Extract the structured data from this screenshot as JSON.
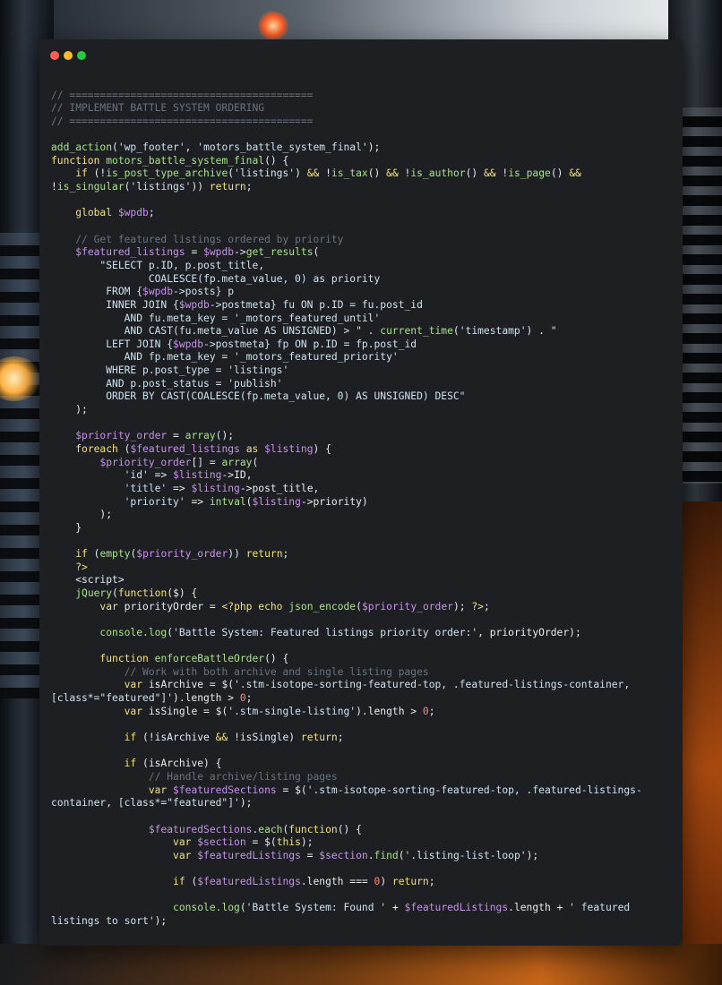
{
  "window": {
    "controls": {
      "close": "#ff5f57",
      "minimize": "#febc2e",
      "maximize": "#28c840"
    }
  },
  "theme": {
    "background": "#1d1f23",
    "colors": {
      "t": "#e6edf3",
      "c": "#6b737c",
      "k": "#f2e27a",
      "f": "#a8e28a",
      "v": "#c792ea",
      "s": "#cfe3ee",
      "h": "#ff7a7a",
      "n": "#ff8a7a"
    }
  },
  "code_lines": [
    [],
    [
      [
        "c",
        "// ========================================"
      ]
    ],
    [
      [
        "c",
        "// IMPLEMENT BATTLE SYSTEM ORDERING"
      ]
    ],
    [
      [
        "c",
        "// ========================================"
      ]
    ],
    [],
    [
      [
        "f",
        "add_action"
      ],
      [
        "t",
        "("
      ],
      [
        "s",
        "'wp_footer'"
      ],
      [
        "t",
        ", "
      ],
      [
        "s",
        "'motors_battle_system_final'"
      ],
      [
        "t",
        ");"
      ]
    ],
    [
      [
        "k",
        "function "
      ],
      [
        "f",
        "motors_battle_system_final"
      ],
      [
        "t",
        "() {"
      ]
    ],
    [
      [
        "t",
        "    "
      ],
      [
        "k",
        "if "
      ],
      [
        "t",
        "(!"
      ],
      [
        "f",
        "is_post_type_archive"
      ],
      [
        "t",
        "("
      ],
      [
        "s",
        "'listings'"
      ],
      [
        "t",
        ") "
      ],
      [
        "k",
        "&&"
      ],
      [
        "t",
        " !"
      ],
      [
        "f",
        "is_tax"
      ],
      [
        "t",
        "() "
      ],
      [
        "k",
        "&&"
      ],
      [
        "t",
        " !"
      ],
      [
        "f",
        "is_author"
      ],
      [
        "t",
        "() "
      ],
      [
        "k",
        "&&"
      ],
      [
        "t",
        " !"
      ],
      [
        "f",
        "is_page"
      ],
      [
        "t",
        "() "
      ],
      [
        "k",
        "&&"
      ]
    ],
    [
      [
        "t",
        "!"
      ],
      [
        "f",
        "is_singular"
      ],
      [
        "t",
        "("
      ],
      [
        "s",
        "'listings'"
      ],
      [
        "t",
        ")) "
      ],
      [
        "k",
        "return"
      ],
      [
        "t",
        ";"
      ]
    ],
    [],
    [
      [
        "t",
        "    "
      ],
      [
        "k",
        "global "
      ],
      [
        "v",
        "$wpdb"
      ],
      [
        "t",
        ";"
      ]
    ],
    [],
    [
      [
        "t",
        "    "
      ],
      [
        "c",
        "// Get featured listings ordered by priority"
      ]
    ],
    [
      [
        "t",
        "    "
      ],
      [
        "v",
        "$featured_listings"
      ],
      [
        "t",
        " = "
      ],
      [
        "v",
        "$wpdb"
      ],
      [
        "t",
        "->"
      ],
      [
        "f",
        "get_results"
      ],
      [
        "t",
        "("
      ]
    ],
    [
      [
        "t",
        "        "
      ],
      [
        "s",
        "\"SELECT p.ID, p.post_title,"
      ]
    ],
    [
      [
        "s",
        "                COALESCE(fp.meta_value, 0) as priority"
      ]
    ],
    [
      [
        "s",
        "         FROM {"
      ],
      [
        "v",
        "$wpdb"
      ],
      [
        "s",
        "->posts} p"
      ]
    ],
    [
      [
        "s",
        "         INNER JOIN {"
      ],
      [
        "v",
        "$wpdb"
      ],
      [
        "s",
        "->postmeta} fu ON p.ID = fu.post_id"
      ]
    ],
    [
      [
        "s",
        "            AND fu.meta_key = '_motors_featured_until'"
      ]
    ],
    [
      [
        "s",
        "            AND CAST(fu.meta_value AS UNSIGNED) > \" . "
      ],
      [
        "f",
        "current_time"
      ],
      [
        "t",
        "("
      ],
      [
        "s",
        "'timestamp'"
      ],
      [
        "t",
        ") . "
      ],
      [
        "s",
        "\""
      ]
    ],
    [
      [
        "s",
        "         LEFT JOIN {"
      ],
      [
        "v",
        "$wpdb"
      ],
      [
        "s",
        "->postmeta} fp ON p.ID = fp.post_id"
      ]
    ],
    [
      [
        "s",
        "            AND fp.meta_key = '_motors_featured_priority'"
      ]
    ],
    [
      [
        "s",
        "         WHERE p.post_type = 'listings'"
      ]
    ],
    [
      [
        "s",
        "         AND p.post_status = 'publish'"
      ]
    ],
    [
      [
        "s",
        "         ORDER BY CAST(COALESCE(fp.meta_value, 0) AS UNSIGNED) DESC\""
      ]
    ],
    [
      [
        "t",
        "    );"
      ]
    ],
    [],
    [
      [
        "t",
        "    "
      ],
      [
        "v",
        "$priority_order"
      ],
      [
        "t",
        " = "
      ],
      [
        "f",
        "array"
      ],
      [
        "t",
        "();"
      ]
    ],
    [
      [
        "t",
        "    "
      ],
      [
        "k",
        "foreach "
      ],
      [
        "t",
        "("
      ],
      [
        "v",
        "$featured_listings"
      ],
      [
        "k",
        " as "
      ],
      [
        "v",
        "$listing"
      ],
      [
        "t",
        ") {"
      ]
    ],
    [
      [
        "t",
        "        "
      ],
      [
        "v",
        "$priority_order"
      ],
      [
        "t",
        "[] = "
      ],
      [
        "f",
        "array"
      ],
      [
        "t",
        "("
      ]
    ],
    [
      [
        "t",
        "            "
      ],
      [
        "s",
        "'id'"
      ],
      [
        "t",
        " => "
      ],
      [
        "v",
        "$listing"
      ],
      [
        "t",
        "->ID,"
      ]
    ],
    [
      [
        "t",
        "            "
      ],
      [
        "s",
        "'title'"
      ],
      [
        "t",
        " => "
      ],
      [
        "v",
        "$listing"
      ],
      [
        "t",
        "->post_title,"
      ]
    ],
    [
      [
        "t",
        "            "
      ],
      [
        "s",
        "'priority'"
      ],
      [
        "t",
        " => "
      ],
      [
        "f",
        "intval"
      ],
      [
        "t",
        "("
      ],
      [
        "v",
        "$listing"
      ],
      [
        "t",
        "->priority)"
      ]
    ],
    [
      [
        "t",
        "        );"
      ]
    ],
    [
      [
        "t",
        "    }"
      ]
    ],
    [],
    [
      [
        "t",
        "    "
      ],
      [
        "k",
        "if "
      ],
      [
        "t",
        "("
      ],
      [
        "f",
        "empty"
      ],
      [
        "t",
        "("
      ],
      [
        "v",
        "$priority_order"
      ],
      [
        "t",
        ")) "
      ],
      [
        "k",
        "return"
      ],
      [
        "t",
        ";"
      ]
    ],
    [
      [
        "t",
        "    "
      ],
      [
        "k",
        "?>"
      ]
    ],
    [
      [
        "t",
        "    <script>"
      ]
    ],
    [
      [
        "t",
        "    "
      ],
      [
        "f",
        "jQuery"
      ],
      [
        "t",
        "("
      ],
      [
        "k",
        "function"
      ],
      [
        "t",
        "($) {"
      ]
    ],
    [
      [
        "t",
        "        "
      ],
      [
        "k",
        "var "
      ],
      [
        "t",
        "priorityOrder = "
      ],
      [
        "k",
        "<?php echo "
      ],
      [
        "f",
        "json_encode"
      ],
      [
        "t",
        "("
      ],
      [
        "v",
        "$priority_order"
      ],
      [
        "t",
        "); "
      ],
      [
        "k",
        "?>"
      ],
      [
        "t",
        ";"
      ]
    ],
    [],
    [
      [
        "t",
        "        "
      ],
      [
        "f",
        "console.log"
      ],
      [
        "t",
        "("
      ],
      [
        "s",
        "'Battle System: Featured listings priority order:'"
      ],
      [
        "t",
        ", priorityOrder);"
      ]
    ],
    [],
    [
      [
        "t",
        "        "
      ],
      [
        "k",
        "function "
      ],
      [
        "f",
        "enforceBattleOrder"
      ],
      [
        "t",
        "() {"
      ]
    ],
    [
      [
        "t",
        "            "
      ],
      [
        "c",
        "// Work with both archive and single listing pages"
      ]
    ],
    [
      [
        "t",
        "            "
      ],
      [
        "k",
        "var "
      ],
      [
        "t",
        "isArchive = $("
      ],
      [
        "s",
        "'.stm-isotope-sorting-featured-top, .featured-listings-container,"
      ]
    ],
    [
      [
        "s",
        "[class*=\"featured\"]'"
      ],
      [
        "t",
        ").length > "
      ],
      [
        "n",
        "0"
      ],
      [
        "t",
        ";"
      ]
    ],
    [
      [
        "t",
        "            "
      ],
      [
        "k",
        "var "
      ],
      [
        "t",
        "isSingle = $("
      ],
      [
        "s",
        "'.stm-single-listing'"
      ],
      [
        "t",
        ").length > "
      ],
      [
        "n",
        "0"
      ],
      [
        "t",
        ";"
      ]
    ],
    [],
    [
      [
        "t",
        "            "
      ],
      [
        "k",
        "if "
      ],
      [
        "t",
        "(!isArchive "
      ],
      [
        "k",
        "&&"
      ],
      [
        "t",
        " !isSingle) "
      ],
      [
        "k",
        "return"
      ],
      [
        "t",
        ";"
      ]
    ],
    [],
    [
      [
        "t",
        "            "
      ],
      [
        "k",
        "if "
      ],
      [
        "t",
        "(isArchive) {"
      ]
    ],
    [
      [
        "t",
        "                "
      ],
      [
        "c",
        "// Handle archive/listing pages"
      ]
    ],
    [
      [
        "t",
        "                "
      ],
      [
        "k",
        "var "
      ],
      [
        "v",
        "$featuredSections"
      ],
      [
        "t",
        " = $("
      ],
      [
        "s",
        "'.stm-isotope-sorting-featured-top, .featured-listings-"
      ]
    ],
    [
      [
        "s",
        "container, [class*=\"featured\"]'"
      ],
      [
        "t",
        ");"
      ]
    ],
    [],
    [
      [
        "t",
        "                "
      ],
      [
        "v",
        "$featuredSections"
      ],
      [
        "t",
        "."
      ],
      [
        "f",
        "each"
      ],
      [
        "t",
        "("
      ],
      [
        "k",
        "function"
      ],
      [
        "t",
        "() {"
      ]
    ],
    [
      [
        "t",
        "                    "
      ],
      [
        "k",
        "var "
      ],
      [
        "v",
        "$section"
      ],
      [
        "t",
        " = $("
      ],
      [
        "k",
        "this"
      ],
      [
        "t",
        ");"
      ]
    ],
    [
      [
        "t",
        "                    "
      ],
      [
        "k",
        "var "
      ],
      [
        "v",
        "$featuredListings"
      ],
      [
        "t",
        " = "
      ],
      [
        "v",
        "$section"
      ],
      [
        "t",
        "."
      ],
      [
        "f",
        "find"
      ],
      [
        "t",
        "("
      ],
      [
        "s",
        "'.listing-list-loop'"
      ],
      [
        "t",
        ");"
      ]
    ],
    [],
    [
      [
        "t",
        "                    "
      ],
      [
        "k",
        "if "
      ],
      [
        "t",
        "("
      ],
      [
        "v",
        "$featuredListings"
      ],
      [
        "t",
        ".length === "
      ],
      [
        "n",
        "0"
      ],
      [
        "t",
        ") "
      ],
      [
        "k",
        "return"
      ],
      [
        "t",
        ";"
      ]
    ],
    [],
    [
      [
        "t",
        "                    "
      ],
      [
        "f",
        "console.log"
      ],
      [
        "t",
        "("
      ],
      [
        "s",
        "'Battle System: Found '"
      ],
      [
        "t",
        " + "
      ],
      [
        "v",
        "$featuredListings"
      ],
      [
        "t",
        ".length + "
      ],
      [
        "s",
        "' featured"
      ]
    ],
    [
      [
        "s",
        "listings to sort'"
      ],
      [
        "t",
        ");"
      ]
    ]
  ]
}
